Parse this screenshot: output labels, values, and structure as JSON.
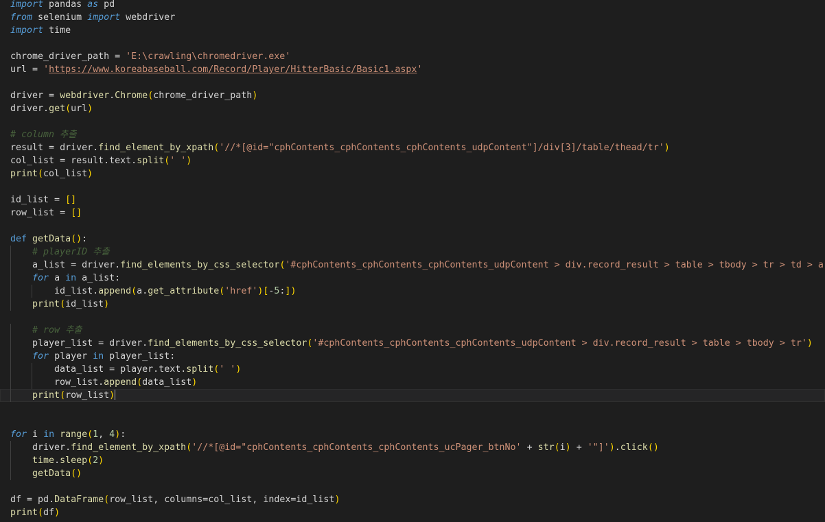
{
  "editor": {
    "lines": [
      [
        [
          "kw-i",
          "import"
        ],
        [
          "tx",
          " pandas "
        ],
        [
          "kw-i",
          "as"
        ],
        [
          "tx",
          " pd"
        ]
      ],
      [
        [
          "kw-i",
          "from"
        ],
        [
          "tx",
          " selenium "
        ],
        [
          "kw-i",
          "import"
        ],
        [
          "tx",
          " webdriver"
        ]
      ],
      [
        [
          "kw-i",
          "import"
        ],
        [
          "tx",
          " time"
        ]
      ],
      [],
      [
        [
          "tx",
          "chrome_driver_path "
        ],
        [
          "op",
          "="
        ],
        [
          "tx",
          " "
        ],
        [
          "str",
          "'E:\\crawling\\chromedriver.exe'"
        ]
      ],
      [
        [
          "tx",
          "url "
        ],
        [
          "op",
          "="
        ],
        [
          "tx",
          " "
        ],
        [
          "str",
          "'"
        ],
        [
          "url",
          "https://www.koreabaseball.com/Record/Player/HitterBasic/Basic1.aspx"
        ],
        [
          "str",
          "'"
        ]
      ],
      [],
      [
        [
          "tx",
          "driver "
        ],
        [
          "op",
          "="
        ],
        [
          "tx",
          " "
        ],
        [
          "fs",
          "webdriver"
        ],
        [
          "op",
          "."
        ],
        [
          "fn",
          "Chrome"
        ],
        [
          "p",
          "("
        ],
        [
          "tx",
          "chrome_driver_path"
        ],
        [
          "p",
          ")"
        ]
      ],
      [
        [
          "tx",
          "driver"
        ],
        [
          "op",
          "."
        ],
        [
          "fn",
          "get"
        ],
        [
          "p",
          "("
        ],
        [
          "tx",
          "url"
        ],
        [
          "p",
          ")"
        ]
      ],
      [],
      [
        [
          "cm",
          "# column 추출"
        ]
      ],
      [
        [
          "tx",
          "result "
        ],
        [
          "op",
          "="
        ],
        [
          "tx",
          " driver"
        ],
        [
          "op",
          "."
        ],
        [
          "fn",
          "find_element_by_xpath"
        ],
        [
          "p",
          "("
        ],
        [
          "str",
          "'//*[@id=\"cphContents_cphContents_cphContents_udpContent\"]/div[3]/table/thead/tr'"
        ],
        [
          "p",
          ")"
        ]
      ],
      [
        [
          "tx",
          "col_list "
        ],
        [
          "op",
          "="
        ],
        [
          "tx",
          " result"
        ],
        [
          "op",
          "."
        ],
        [
          "tx",
          "text"
        ],
        [
          "op",
          "."
        ],
        [
          "fn",
          "split"
        ],
        [
          "p",
          "("
        ],
        [
          "str",
          "' '"
        ],
        [
          "p",
          ")"
        ]
      ],
      [
        [
          "fn",
          "print"
        ],
        [
          "p",
          "("
        ],
        [
          "tx",
          "col_list"
        ],
        [
          "p",
          ")"
        ]
      ],
      [],
      [
        [
          "tx",
          "id_list "
        ],
        [
          "op",
          "="
        ],
        [
          "tx",
          " "
        ],
        [
          "p",
          "[]"
        ]
      ],
      [
        [
          "tx",
          "row_list "
        ],
        [
          "op",
          "="
        ],
        [
          "tx",
          " "
        ],
        [
          "p",
          "[]"
        ]
      ],
      [],
      [
        [
          "kw",
          "def"
        ],
        [
          "tx",
          " "
        ],
        [
          "fn",
          "getData"
        ],
        [
          "p",
          "()"
        ],
        [
          "tx",
          ":"
        ]
      ],
      [
        [
          "tx",
          "    "
        ],
        [
          "cm",
          "# playerID 추출"
        ]
      ],
      [
        [
          "tx",
          "    a_list "
        ],
        [
          "op",
          "="
        ],
        [
          "tx",
          " driver"
        ],
        [
          "op",
          "."
        ],
        [
          "fn",
          "find_elements_by_css_selector"
        ],
        [
          "p",
          "("
        ],
        [
          "str",
          "'#cphContents_cphContents_cphContents_udpContent > div.record_result > table > tbody > tr > td > a'"
        ],
        [
          "p",
          ")"
        ]
      ],
      [
        [
          "tx",
          "    "
        ],
        [
          "kw-i",
          "for"
        ],
        [
          "tx",
          " a "
        ],
        [
          "kw",
          "in"
        ],
        [
          "tx",
          " a_list:"
        ]
      ],
      [
        [
          "tx",
          "        id_list"
        ],
        [
          "op",
          "."
        ],
        [
          "fn",
          "append"
        ],
        [
          "p",
          "("
        ],
        [
          "tx",
          "a"
        ],
        [
          "op",
          "."
        ],
        [
          "fn",
          "get_attribute"
        ],
        [
          "p",
          "("
        ],
        [
          "str",
          "'href'"
        ],
        [
          "p",
          ")"
        ],
        [
          "p",
          "["
        ],
        [
          "op",
          "-"
        ],
        [
          "num",
          "5"
        ],
        [
          "tx",
          ":"
        ],
        [
          "p",
          "]"
        ],
        [
          "p",
          ")"
        ]
      ],
      [
        [
          "tx",
          "    "
        ],
        [
          "fn",
          "print"
        ],
        [
          "p",
          "("
        ],
        [
          "tx",
          "id_list"
        ],
        [
          "p",
          ")"
        ]
      ],
      [],
      [
        [
          "tx",
          "    "
        ],
        [
          "cm",
          "# row 추출"
        ]
      ],
      [
        [
          "tx",
          "    player_list "
        ],
        [
          "op",
          "="
        ],
        [
          "tx",
          " driver"
        ],
        [
          "op",
          "."
        ],
        [
          "fn",
          "find_elements_by_css_selector"
        ],
        [
          "p",
          "("
        ],
        [
          "str",
          "'#cphContents_cphContents_cphContents_udpContent > div.record_result > table > tbody > tr'"
        ],
        [
          "p",
          ")"
        ]
      ],
      [
        [
          "tx",
          "    "
        ],
        [
          "kw-i",
          "for"
        ],
        [
          "tx",
          " player "
        ],
        [
          "kw",
          "in"
        ],
        [
          "tx",
          " player_list:"
        ]
      ],
      [
        [
          "tx",
          "        data_list "
        ],
        [
          "op",
          "="
        ],
        [
          "tx",
          " player"
        ],
        [
          "op",
          "."
        ],
        [
          "tx",
          "text"
        ],
        [
          "op",
          "."
        ],
        [
          "fn",
          "split"
        ],
        [
          "p",
          "("
        ],
        [
          "str",
          "' '"
        ],
        [
          "p",
          ")"
        ]
      ],
      [
        [
          "tx",
          "        row_list"
        ],
        [
          "op",
          "."
        ],
        [
          "fn",
          "append"
        ],
        [
          "p",
          "("
        ],
        [
          "tx",
          "data_list"
        ],
        [
          "p",
          ")"
        ]
      ],
      [
        [
          "tx",
          "    "
        ],
        [
          "fn",
          "print"
        ],
        [
          "p",
          "("
        ],
        [
          "tx",
          "row_list"
        ],
        [
          "p",
          ")"
        ]
      ],
      [],
      [],
      [
        [
          "kw-i",
          "for"
        ],
        [
          "tx",
          " i "
        ],
        [
          "kw",
          "in"
        ],
        [
          "tx",
          " "
        ],
        [
          "fn",
          "range"
        ],
        [
          "p",
          "("
        ],
        [
          "num",
          "1"
        ],
        [
          "tx",
          ", "
        ],
        [
          "num",
          "4"
        ],
        [
          "p",
          ")"
        ],
        [
          "tx",
          ":"
        ]
      ],
      [
        [
          "tx",
          "    driver"
        ],
        [
          "op",
          "."
        ],
        [
          "fn",
          "find_element_by_xpath"
        ],
        [
          "p",
          "("
        ],
        [
          "str",
          "'//*[@id=\"cphContents_cphContents_cphContents_ucPager_btnNo'"
        ],
        [
          "tx",
          " "
        ],
        [
          "op",
          "+"
        ],
        [
          "tx",
          " "
        ],
        [
          "fn",
          "str"
        ],
        [
          "p",
          "("
        ],
        [
          "tx",
          "i"
        ],
        [
          "p",
          ")"
        ],
        [
          "tx",
          " "
        ],
        [
          "op",
          "+"
        ],
        [
          "tx",
          " "
        ],
        [
          "str",
          "'\"]'"
        ],
        [
          "p",
          ")"
        ],
        [
          "op",
          "."
        ],
        [
          "fn",
          "click"
        ],
        [
          "p",
          "()"
        ]
      ],
      [
        [
          "tx",
          "    "
        ],
        [
          "fs",
          "time"
        ],
        [
          "op",
          "."
        ],
        [
          "fn",
          "sleep"
        ],
        [
          "p",
          "("
        ],
        [
          "num",
          "2"
        ],
        [
          "p",
          ")"
        ]
      ],
      [
        [
          "tx",
          "    "
        ],
        [
          "fn",
          "getData"
        ],
        [
          "p",
          "()"
        ]
      ],
      [],
      [
        [
          "tx",
          "df "
        ],
        [
          "op",
          "="
        ],
        [
          "tx",
          " pd"
        ],
        [
          "op",
          "."
        ],
        [
          "fn",
          "DataFrame"
        ],
        [
          "p",
          "("
        ],
        [
          "tx",
          "row_list, columns"
        ],
        [
          "op",
          "="
        ],
        [
          "tx",
          "col_list, index"
        ],
        [
          "op",
          "="
        ],
        [
          "tx",
          "id_list"
        ],
        [
          "p",
          ")"
        ]
      ],
      [
        [
          "fn",
          "print"
        ],
        [
          "p",
          "("
        ],
        [
          "tx",
          "df"
        ],
        [
          "p",
          ")"
        ]
      ]
    ]
  }
}
